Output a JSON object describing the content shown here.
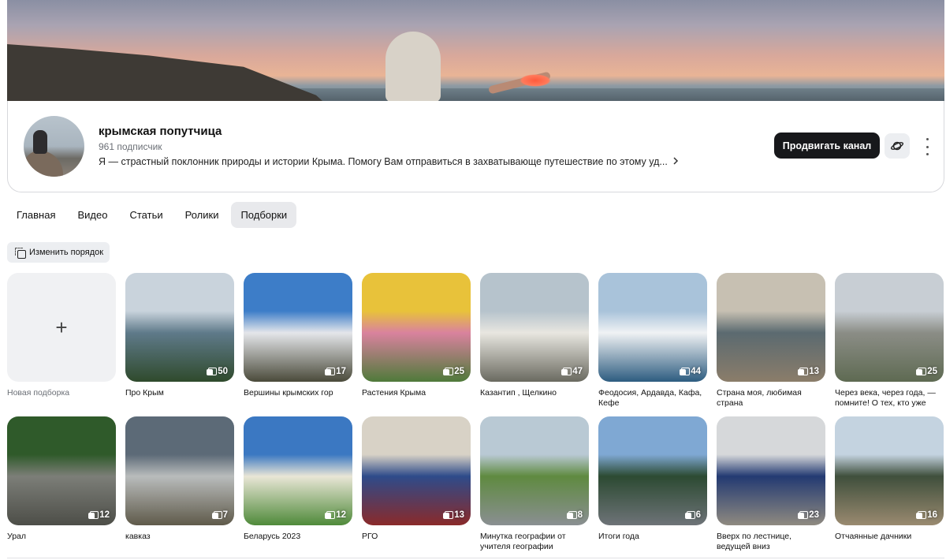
{
  "channel": {
    "name": "крымская попутчица",
    "subscribers": "961 подписчик",
    "description": "Я — страстный поклонник природы и истории Крыма. Помогу Вам отправиться в захватывающе путешествие по этому уд...",
    "promote_button": "Продвигать канал"
  },
  "tabs": [
    {
      "label": "Главная",
      "active": false
    },
    {
      "label": "Видео",
      "active": false
    },
    {
      "label": "Статьи",
      "active": false
    },
    {
      "label": "Ролики",
      "active": false
    },
    {
      "label": "Подборки",
      "active": true
    }
  ],
  "reorder_button": "Изменить порядок",
  "new_collection": {
    "label": "Новая подборка",
    "plus": "+"
  },
  "collections": [
    {
      "title": "Про Крым",
      "count": "50",
      "colors": [
        "#c9d3dc",
        "#5f7a8a",
        "#2f4a2c"
      ]
    },
    {
      "title": "Вершины крымских гор",
      "count": "17",
      "colors": [
        "#3d7dc8",
        "#e4e6ea",
        "#4a4a3a"
      ]
    },
    {
      "title": "Растения Крыма",
      "count": "25",
      "colors": [
        "#e8c23a",
        "#d9829e",
        "#4f7a3a"
      ]
    },
    {
      "title": "Казантип , Щелкино",
      "count": "47",
      "colors": [
        "#b6c3cc",
        "#e8e6e0",
        "#6a6a60"
      ]
    },
    {
      "title": "Феодосия, Ардавда, Кафа, Кефе",
      "count": "44",
      "colors": [
        "#a9c3da",
        "#f0f2f4",
        "#2d5c80"
      ]
    },
    {
      "title": "Страна моя, любимая страна",
      "count": "13",
      "colors": [
        "#c7c0b2",
        "#5b6a70",
        "#8b7d6a"
      ]
    },
    {
      "title": "Через века, через года, — помните! О тех, кто уже не...",
      "count": "25",
      "colors": [
        "#c8ced4",
        "#8b8d86",
        "#5e6a52"
      ]
    },
    {
      "title": "Урал",
      "count": "12",
      "colors": [
        "#2f5a2a",
        "#7c7e78",
        "#4d4e48"
      ]
    },
    {
      "title": "кавказ",
      "count": "7",
      "colors": [
        "#5c6a77",
        "#b9bcbc",
        "#5f5a4a"
      ]
    },
    {
      "title": "Беларусь 2023",
      "count": "12",
      "colors": [
        "#3b78c2",
        "#e9e6d6",
        "#4f8a3a"
      ]
    },
    {
      "title": "РГО",
      "count": "13",
      "colors": [
        "#d8d2c6",
        "#2e4b8a",
        "#8a2a2a"
      ]
    },
    {
      "title": "Минутка географии от учителя географии",
      "count": "8",
      "colors": [
        "#b9c9d4",
        "#5f8a40",
        "#8a8f92"
      ]
    },
    {
      "title": "Итоги года",
      "count": "6",
      "colors": [
        "#7fa8d3",
        "#2c4a32",
        "#6e7378"
      ]
    },
    {
      "title": "Вверх по лестнице, ведущей вниз",
      "count": "23",
      "colors": [
        "#d6d8da",
        "#233a72",
        "#8f8a80"
      ]
    },
    {
      "title": "Отчаянные дачники",
      "count": "16",
      "colors": [
        "#c4d3e0",
        "#3f4f3c",
        "#9a8a70"
      ]
    }
  ]
}
